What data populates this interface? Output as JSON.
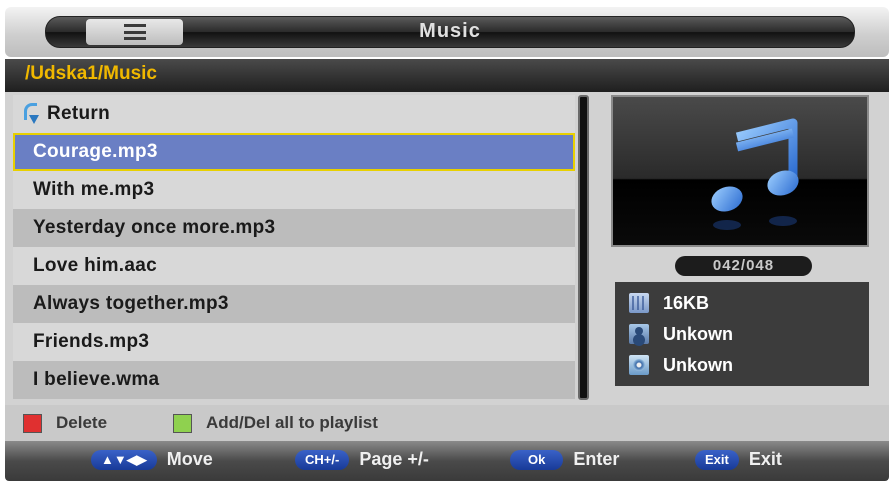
{
  "header": {
    "title": "Music",
    "menu_icon": "list-icon"
  },
  "path": "/Udska1/Music",
  "list": {
    "return_label": "Return",
    "files": [
      "Courage.mp3",
      "With me.mp3",
      "Yesterday once more.mp3",
      "Love him.aac",
      "Always together.mp3",
      "Friends.mp3",
      "I believe.wma"
    ],
    "selected_index": 0
  },
  "preview": {
    "icon": "music-note-icon",
    "counter": "042/048"
  },
  "info": {
    "size": "16KB",
    "artist": "Unkown",
    "album": "Unkown"
  },
  "legend": {
    "red_label": "Delete",
    "green_label": "Add/Del all to playlist",
    "red_color": "#e03030",
    "green_color": "#8fd14f"
  },
  "hints": [
    {
      "key": "▲▼◀▶",
      "label": "Move"
    },
    {
      "key": "CH+/-",
      "label": "Page +/-"
    },
    {
      "key": "Ok",
      "label": "Enter"
    },
    {
      "key": "Exit",
      "label": "Exit"
    }
  ]
}
